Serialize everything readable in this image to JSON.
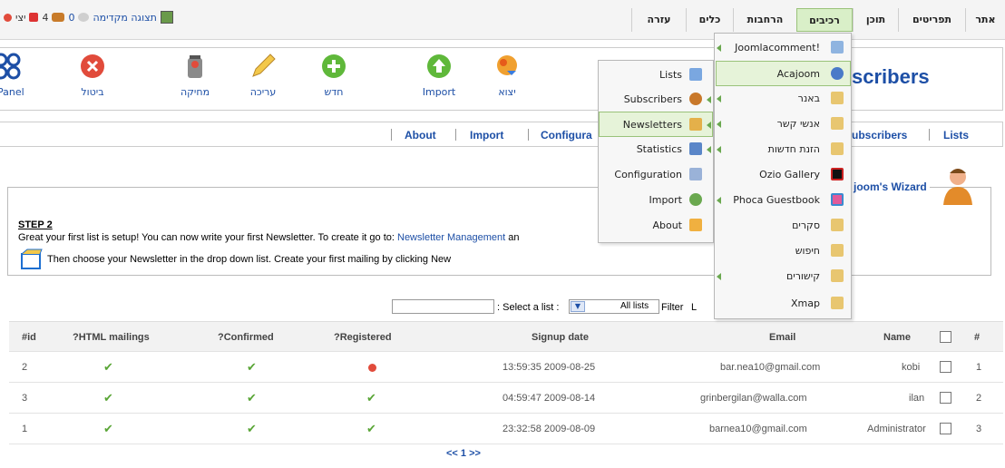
{
  "menubar": {
    "tabs": [
      {
        "label": "אתר",
        "active": false
      },
      {
        "label": "תפריטים",
        "active": false
      },
      {
        "label": "תוכן",
        "active": false
      },
      {
        "label": "רכיבים",
        "active": true
      },
      {
        "label": "הרחבות",
        "active": false
      },
      {
        "label": "כלים",
        "active": false
      },
      {
        "label": "עזרה",
        "active": false
      }
    ],
    "status": {
      "preview": "תצוגה מקדימה",
      "messages_count": "0",
      "users_count": "4",
      "logout": "יצי"
    }
  },
  "toolbar": {
    "title": "scribers",
    "buttons": [
      {
        "label": "יצוא",
        "icon": "export-icon"
      },
      {
        "label": "Import",
        "icon": "import-icon"
      },
      {
        "label": "חדש",
        "icon": "new-icon"
      },
      {
        "label": "עריכה",
        "icon": "edit-icon"
      },
      {
        "label": "מחיקה",
        "icon": "delete-icon"
      },
      {
        "label": "ביטול",
        "icon": "cancel-icon"
      },
      {
        "label": "CPanel",
        "icon": "cpanel-icon"
      }
    ]
  },
  "submenu": {
    "links": [
      "About",
      "Import",
      "Configura",
      "ubscribers",
      "Lists"
    ]
  },
  "wizard": {
    "title": "joom's Wizard",
    "step": "STEP 2",
    "message": "Great your first list is setup! You can now write your first Newsletter. To create it go to:",
    "link": "Newsletter Management",
    "message_tail": "an",
    "message2": "Then choose your Newsletter in the drop down list. Create your first mailing by clicking New"
  },
  "filter": {
    "select_label": ": Select a list :",
    "selected": "All lists",
    "filter_label": "Filter",
    "extra": "L"
  },
  "table": {
    "headers": {
      "id": "#id",
      "html": "?HTML mailings",
      "confirmed": "?Confirmed",
      "registered": "?Registered",
      "signup": "Signup date",
      "email": "Email",
      "name": "Name",
      "num": "#"
    },
    "rows": [
      {
        "id": "2",
        "html": true,
        "confirmed": true,
        "registered": false,
        "signup": "13:59:35 2009-08-25",
        "email": "bar.nea10@gmail.com",
        "name": "kobi",
        "num": "1"
      },
      {
        "id": "3",
        "html": true,
        "confirmed": true,
        "registered": true,
        "signup": "04:59:47 2009-08-14",
        "email": "grinbergilan@walla.com",
        "name": "ilan",
        "num": "2"
      },
      {
        "id": "1",
        "html": true,
        "confirmed": true,
        "registered": true,
        "signup": "23:32:58 2009-08-09",
        "email": "barnea10@gmail.com",
        "name": "Administrator",
        "num": "3"
      }
    ],
    "pager": "<< 1 >>"
  },
  "components_menu": [
    {
      "label": "Joomlacomment!",
      "submenu": true
    },
    {
      "label": "Acajoom",
      "submenu": false,
      "selected": true
    },
    {
      "label": "באנר",
      "submenu": true
    },
    {
      "label": "אנשי קשר",
      "submenu": true
    },
    {
      "label": "הזנת חדשות",
      "submenu": true
    },
    {
      "label": "Ozio Gallery",
      "submenu": false
    },
    {
      "label": "Phoca Guestbook",
      "submenu": true
    },
    {
      "label": "סקרים",
      "submenu": false
    },
    {
      "label": "חיפוש",
      "submenu": false
    },
    {
      "label": "קישורים",
      "submenu": true
    },
    {
      "label": "Xmap",
      "submenu": false
    }
  ],
  "acajoom_menu": [
    {
      "label": "Lists",
      "submenu": false
    },
    {
      "label": "Subscribers",
      "submenu": true
    },
    {
      "label": "Newsletters",
      "submenu": true,
      "selected": true
    },
    {
      "label": "Statistics",
      "submenu": true
    },
    {
      "label": "Configuration",
      "submenu": false
    },
    {
      "label": "Import",
      "submenu": false
    },
    {
      "label": "About",
      "submenu": false
    }
  ],
  "colors": {
    "accent": "#1d4fa6",
    "check": "#59a536",
    "active_tab": "#d9efc8",
    "error": "#e14b3b"
  }
}
